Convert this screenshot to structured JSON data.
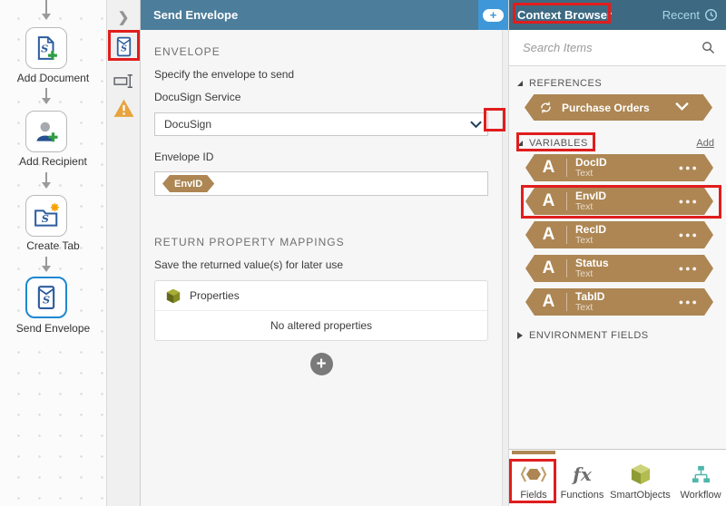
{
  "colors": {
    "header-blue": "#4c7d9b",
    "context-header": "#3d6a82",
    "accent-blue": "#3e97d8",
    "tan": "#ad8653",
    "red": "#e11d1d",
    "node-blue": "#2d5c9e",
    "orange": "#e8a33d",
    "green": "#2f9e44",
    "teal": "#4fb6aa"
  },
  "canvas": {
    "nodes": [
      {
        "label": "Add Document"
      },
      {
        "label": "Add Recipient"
      },
      {
        "label": "Create Tab"
      },
      {
        "label": "Send Envelope"
      }
    ]
  },
  "panel": {
    "title": "Send Envelope",
    "envelope_section": {
      "title": "ENVELOPE",
      "description": "Specify the envelope to send",
      "service_label": "DocuSign Service",
      "service_value": "DocuSign",
      "envelope_id_label": "Envelope ID",
      "envelope_id_token": "EnvID"
    },
    "mappings_section": {
      "title": "RETURN PROPERTY MAPPINGS",
      "description": "Save the returned value(s) for later use",
      "card_title": "Properties",
      "empty_message": "No altered properties",
      "add_button": "+"
    }
  },
  "context_browser": {
    "title": "Context Browser",
    "recent_label": "Recent",
    "search_placeholder": "Search Items",
    "references": {
      "title": "REFERENCES",
      "items": [
        {
          "name": "Purchase Orders"
        }
      ]
    },
    "variables": {
      "title": "VARIABLES",
      "add_label": "Add",
      "items": [
        {
          "name": "DocID",
          "type": "Text"
        },
        {
          "name": "EnvID",
          "type": "Text"
        },
        {
          "name": "RecID",
          "type": "Text"
        },
        {
          "name": "Status",
          "type": "Text"
        },
        {
          "name": "TabID",
          "type": "Text"
        }
      ]
    },
    "environment_fields": {
      "title": "ENVIRONMENT FIELDS"
    },
    "tabs": [
      {
        "label": "Fields"
      },
      {
        "label": "Functions"
      },
      {
        "label": "SmartObjects"
      },
      {
        "label": "Workflow"
      }
    ]
  }
}
